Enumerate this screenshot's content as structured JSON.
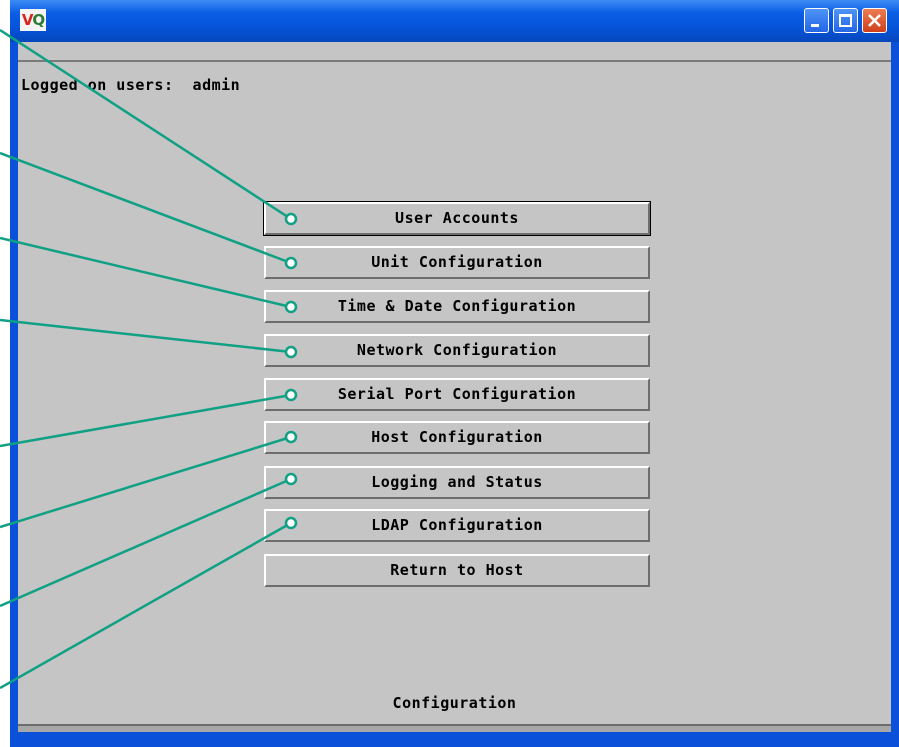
{
  "window": {
    "app_icon": {
      "left": "V",
      "right": "Q"
    },
    "icons": [
      "app-logo-icon",
      "minimize-icon",
      "maximize-icon",
      "close-icon"
    ]
  },
  "header": {
    "logged_users": "Logged on users:  admin"
  },
  "menu": {
    "buttons": [
      "User Accounts",
      "Unit Configuration",
      "Time & Date Configuration",
      "Network Configuration",
      "Serial Port Configuration",
      "Host Configuration",
      "Logging and Status",
      "LDAP Configuration",
      "Return to Host"
    ]
  },
  "status": {
    "label": "Configuration"
  },
  "colors": {
    "titlebar": "#0552d6",
    "client_bg": "#c5c5c5",
    "callout": "#10a084",
    "close_button": "#d94a24"
  }
}
